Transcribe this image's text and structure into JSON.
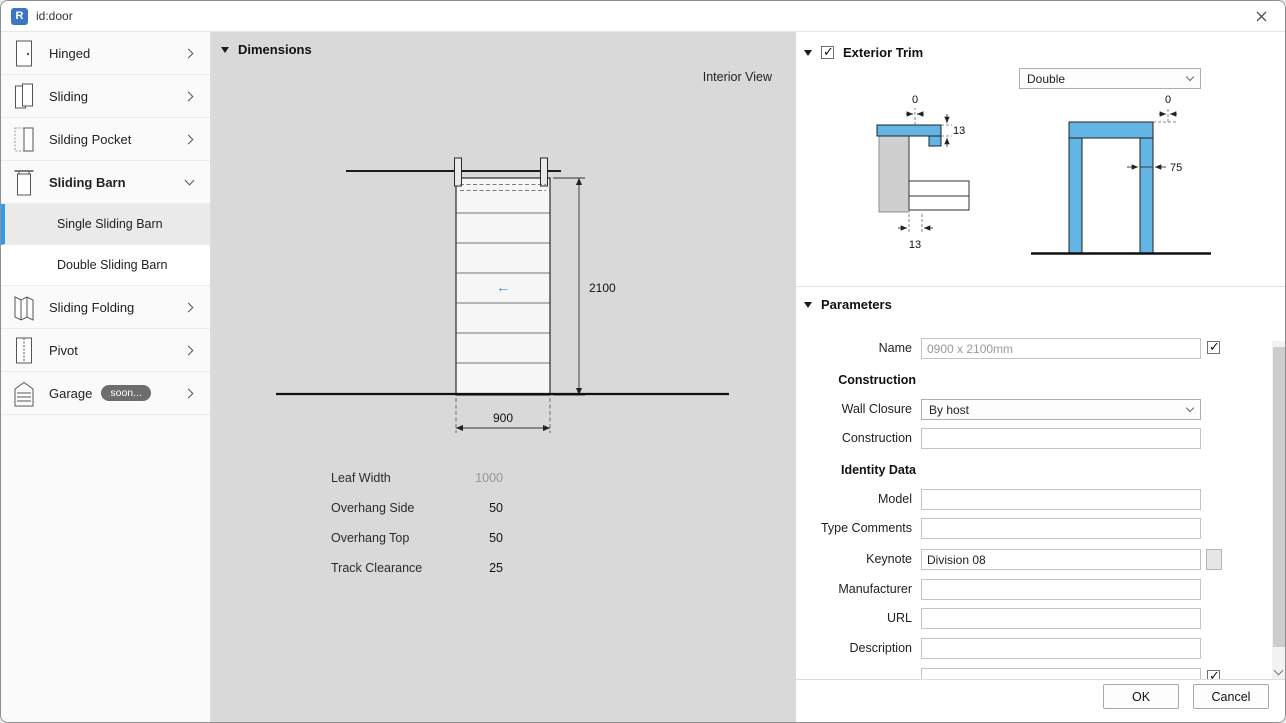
{
  "window": {
    "title": "id:door",
    "logo_letter": "R"
  },
  "colors": {
    "accent": "#2D9BF0",
    "trim": "#63B5E5",
    "panel_bg": "#D9D9D9"
  },
  "sidebar": {
    "items": [
      {
        "label": "Hinged"
      },
      {
        "label": "Sliding"
      },
      {
        "label": "Silding Pocket"
      },
      {
        "label": "Sliding Barn"
      },
      {
        "label": "Sliding Folding"
      },
      {
        "label": "Pivot"
      },
      {
        "label": "Garage",
        "badge": "soon..."
      }
    ],
    "subitems": [
      {
        "label": "Single Sliding Barn"
      },
      {
        "label": "Double Sliding Barn"
      }
    ]
  },
  "dimensions": {
    "title": "Dimensions",
    "view_label": "Interior View",
    "height_dim": "2100",
    "width_dim": "900",
    "slide_arrow": "←",
    "params": [
      {
        "label": "Leaf Width",
        "value": "1000"
      },
      {
        "label": "Overhang Side",
        "value": "50"
      },
      {
        "label": "Overhang Top",
        "value": "50"
      },
      {
        "label": "Track Clearance",
        "value": "25"
      }
    ]
  },
  "exterior_trim": {
    "title": "Exterior Trim",
    "style_value": "Double",
    "plan_dims": {
      "top": "0",
      "side": "13",
      "bottom": "13"
    },
    "elev_dims": {
      "top": "0",
      "side": "75"
    }
  },
  "parameters": {
    "title": "Parameters",
    "name_label": "Name",
    "name_value": "0900 x 2100mm",
    "construction_header": "Construction",
    "wall_closure_label": "Wall Closure",
    "wall_closure_value": "By host",
    "construction_label": "Construction",
    "identity_header": "Identity Data",
    "model_label": "Model",
    "type_comments_label": "Type Comments",
    "keynote_label": "Keynote",
    "keynote_value": "Division 08",
    "manufacturer_label": "Manufacturer",
    "url_label": "URL",
    "description_label": "Description"
  },
  "footer": {
    "ok": "OK",
    "cancel": "Cancel"
  }
}
